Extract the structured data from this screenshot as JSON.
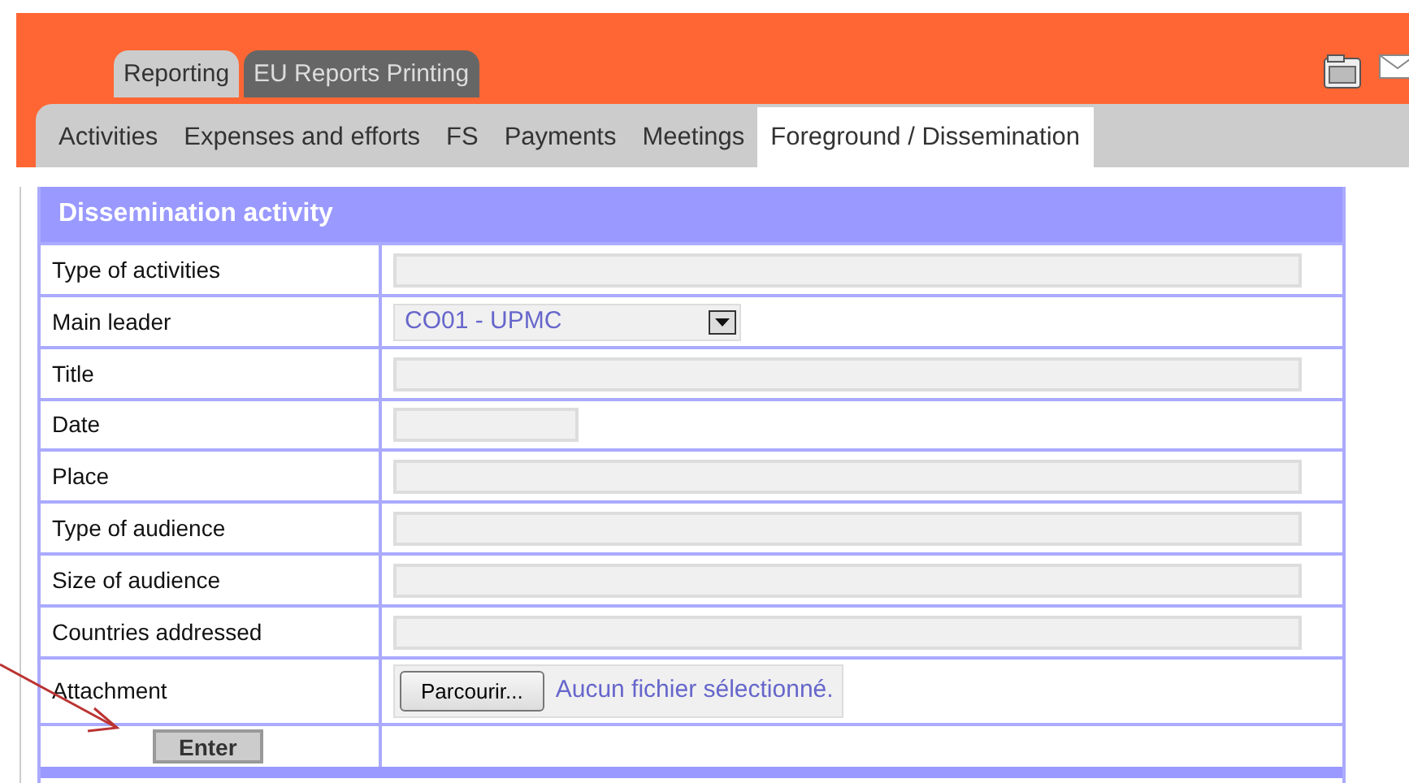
{
  "top_tabs": [
    {
      "label": "Reporting",
      "selected": true
    },
    {
      "label": "EU Reports Printing",
      "selected": false
    }
  ],
  "sub_tabs": [
    {
      "label": "Activities",
      "selected": false
    },
    {
      "label": "Expenses and efforts",
      "selected": false
    },
    {
      "label": "FS",
      "selected": false
    },
    {
      "label": "Payments",
      "selected": false
    },
    {
      "label": "Meetings",
      "selected": false
    },
    {
      "label": "Foreground / Dissemination",
      "selected": true
    }
  ],
  "form": {
    "title": "Dissemination activity",
    "rows": [
      {
        "label": "Type of activities",
        "kind": "text"
      },
      {
        "label": "Main leader",
        "kind": "select",
        "value": "CO01 - UPMC"
      },
      {
        "label": "Title",
        "kind": "text"
      },
      {
        "label": "Date",
        "kind": "date"
      },
      {
        "label": "Place",
        "kind": "text"
      },
      {
        "label": "Type of audience",
        "kind": "text"
      },
      {
        "label": "Size of audience",
        "kind": "text"
      },
      {
        "label": "Countries addressed",
        "kind": "text"
      },
      {
        "label": "Attachment",
        "kind": "file",
        "button": "Parcourir...",
        "value": "Aucun fichier sélectionné."
      }
    ],
    "submit": "Enter"
  }
}
